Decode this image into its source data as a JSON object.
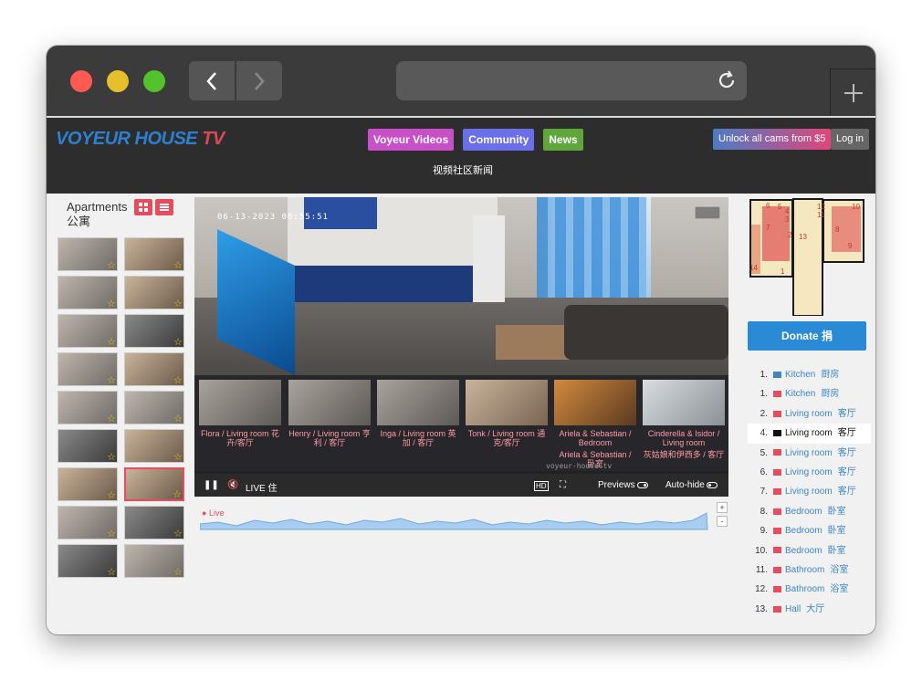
{
  "browser": {
    "url": ""
  },
  "header": {
    "logo_main": "VOYEUR HOUSE",
    "logo_tv": "TV",
    "nav": [
      {
        "label": "Voyeur Videos",
        "color": "#c84fc7"
      },
      {
        "label": "Community",
        "color": "#6a6ee8"
      },
      {
        "label": "News",
        "color": "#5fa63b"
      }
    ],
    "nav_cn": "视频社区新闻",
    "unlock_label": "Unlock all cams from $5",
    "login_label": "Log in"
  },
  "apartments": {
    "title": "Apartments 公寓"
  },
  "player": {
    "timestamp": "06-13-2023 00:55:51",
    "watermark": "voyeur-house.tv",
    "live_label": "LIVE 住",
    "previews_label": "Previews",
    "autohide_label": "Auto-hide",
    "previews": [
      {
        "label": "Flora / Living room 花卉/客厅",
        "label2": ""
      },
      {
        "label": "Henry / Living room 亨利 / 客厅",
        "label2": ""
      },
      {
        "label": "Inga / Living room 英加 / 客厅",
        "label2": ""
      },
      {
        "label": "Tonk / Living room 通克/客厅",
        "label2": ""
      },
      {
        "label": "Ariela & Sebastian / Bedroom",
        "label2": "Ariela & Sebastian / 卧室"
      },
      {
        "label": "Cinderella & Isidor / Living room",
        "label2": "灰姑娘和伊西多 / 客厅"
      }
    ]
  },
  "timeline": {
    "live": "Live",
    "zoom_in": "+",
    "zoom_out": "-"
  },
  "sidebar": {
    "donate_label": "Donate 捐",
    "cams": [
      {
        "num": "1.",
        "name": "Kitchen",
        "cn": "厨房",
        "icon": "blue"
      },
      {
        "num": "1.",
        "name": "Kitchen",
        "cn": "厨房",
        "icon": "red"
      },
      {
        "num": "2.",
        "name": "Living room",
        "cn": "客厅",
        "icon": "red"
      },
      {
        "num": "4.",
        "name": "Living room",
        "cn": "客厅",
        "icon": "black"
      },
      {
        "num": "5.",
        "name": "Living room",
        "cn": "客厅",
        "icon": "red"
      },
      {
        "num": "6.",
        "name": "Living room",
        "cn": "客厅",
        "icon": "red"
      },
      {
        "num": "7.",
        "name": "Living room",
        "cn": "客厅",
        "icon": "red"
      },
      {
        "num": "8.",
        "name": "Bedroom",
        "cn": "卧室",
        "icon": "red"
      },
      {
        "num": "9.",
        "name": "Bedroom",
        "cn": "卧室",
        "icon": "red"
      },
      {
        "num": "10.",
        "name": "Bedroom",
        "cn": "卧室",
        "icon": "red"
      },
      {
        "num": "11.",
        "name": "Bathroom",
        "cn": "浴室",
        "icon": "red"
      },
      {
        "num": "12.",
        "name": "Bathroom",
        "cn": "浴室",
        "icon": "red"
      },
      {
        "num": "13.",
        "name": "Hall",
        "cn": "大厅",
        "icon": "red"
      }
    ],
    "map_numbers": [
      "6",
      "5",
      "4",
      "3",
      "7",
      "2",
      "13",
      "12",
      "11",
      "8",
      "10",
      "9",
      "1",
      "14"
    ]
  }
}
